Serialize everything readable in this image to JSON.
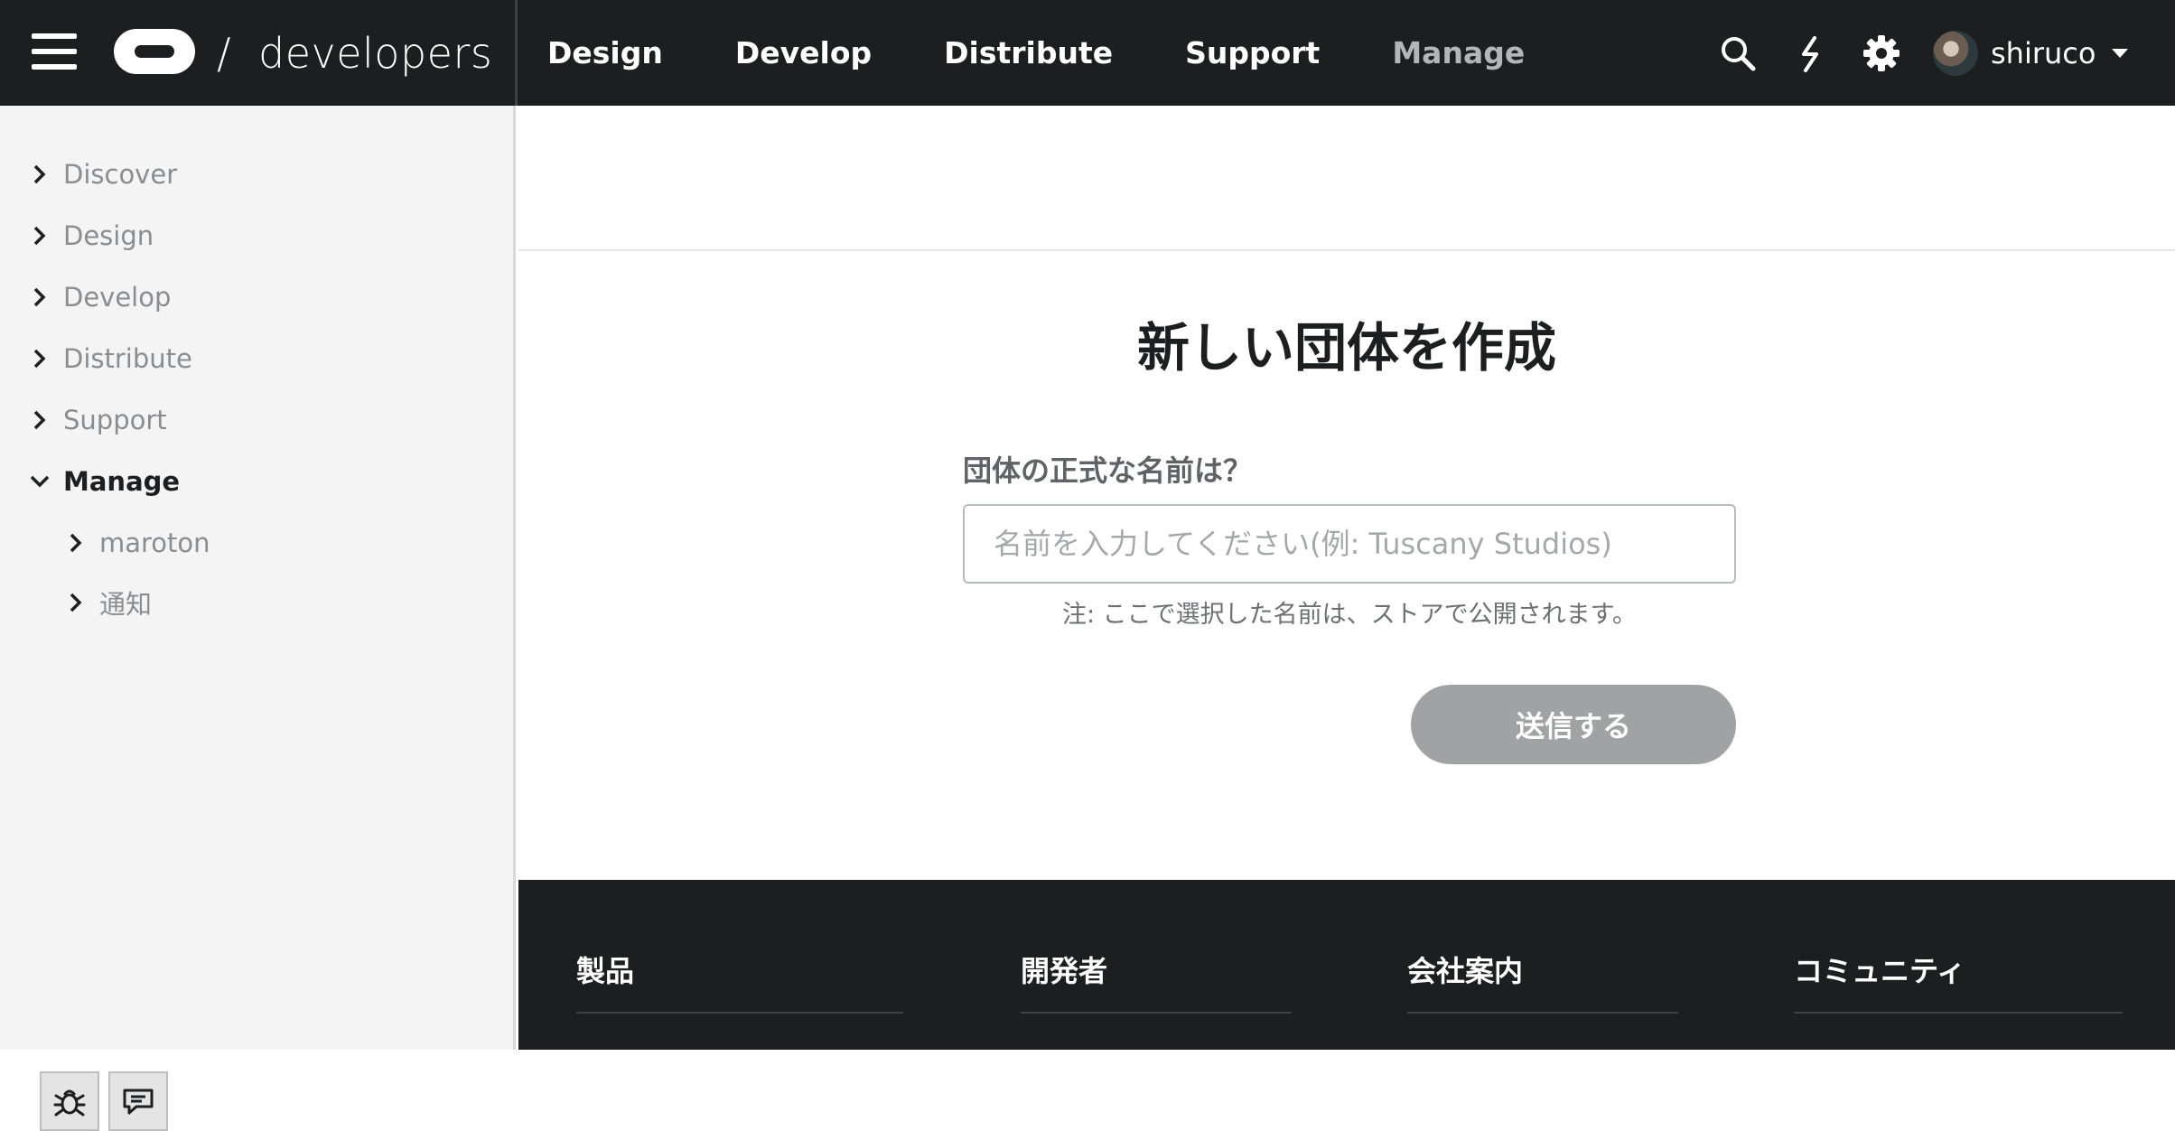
{
  "header": {
    "brand_slash": "/",
    "brand_text": "developers",
    "nav": [
      "Design",
      "Develop",
      "Distribute",
      "Support",
      "Manage"
    ],
    "active_nav": "Manage",
    "icons": [
      "search-icon",
      "bolt-icon",
      "gear-icon"
    ],
    "user": {
      "name": "shiruco"
    }
  },
  "sidebar": {
    "items": [
      {
        "label": "Discover",
        "expanded": false
      },
      {
        "label": "Design",
        "expanded": false
      },
      {
        "label": "Develop",
        "expanded": false
      },
      {
        "label": "Distribute",
        "expanded": false
      },
      {
        "label": "Support",
        "expanded": false
      },
      {
        "label": "Manage",
        "expanded": true
      }
    ],
    "subitems": [
      {
        "label": "maroton"
      },
      {
        "label": "通知"
      }
    ],
    "tools": [
      "bug-icon",
      "feedback-icon"
    ]
  },
  "main": {
    "title": "新しい団体を作成",
    "field_label": "団体の正式な名前は？",
    "input_placeholder": "名前を入力してください(例: Tuscany Studios)",
    "input_value": "",
    "note": "注: ここで選択した名前は、ストアで公開されます。",
    "submit_label": "送信する"
  },
  "footer": {
    "columns": [
      "製品",
      "開発者",
      "会社案内",
      "コミュニティ"
    ]
  },
  "colors": {
    "nav_bg": "#1c1e20",
    "active_nav": "#b2b6bb",
    "submit_disabled": "#a0a2a4"
  }
}
